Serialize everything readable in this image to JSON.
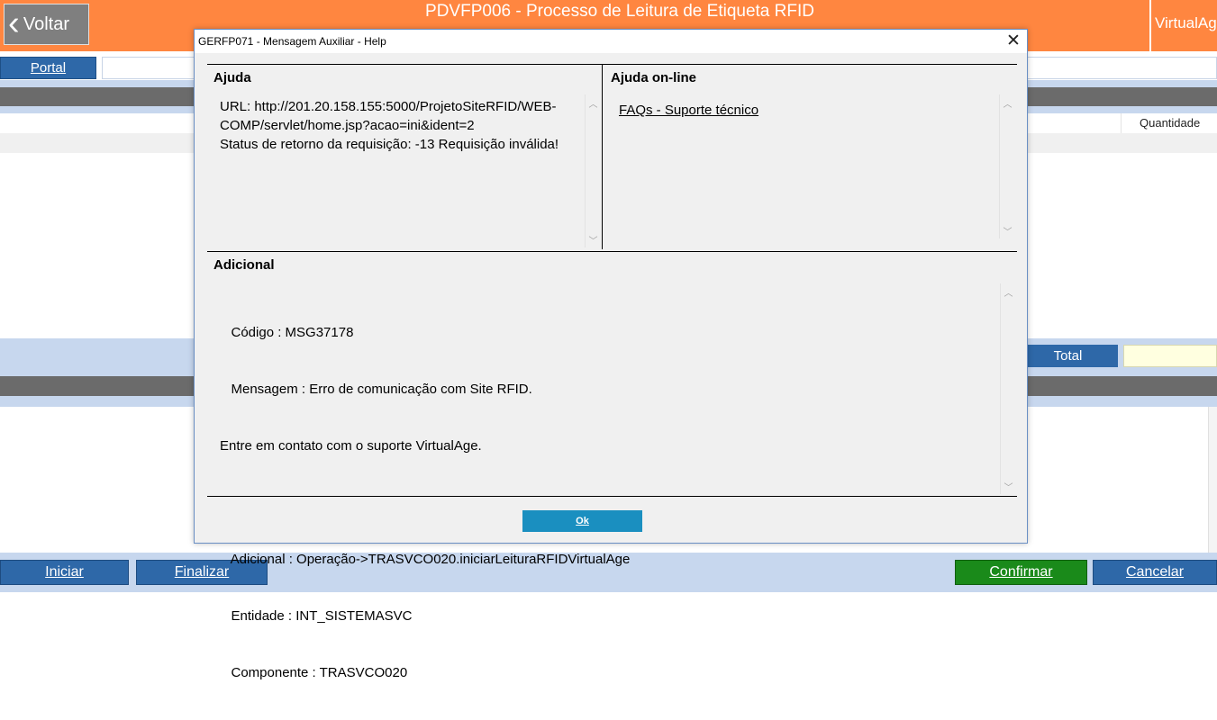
{
  "app": {
    "back_label": "Voltar",
    "back_chevron": "‹",
    "title": "PDVFP006 - Processo de Leitura de Etiqueta RFID",
    "brand": "VirtualAge",
    "portal_label": "Portal",
    "column_quantidade": "Quantidade",
    "total_label": "Total",
    "buttons": {
      "iniciar": "Iniciar",
      "finalizar": "Finalizar",
      "confirmar": "Confirmar",
      "cancelar": "Cancelar"
    },
    "colors": {
      "header_orange": "#ff8640",
      "button_blue": "#2e68a8",
      "confirm_green": "#1a8a1a",
      "band_gray": "#6b6b6b",
      "band_light_blue": "#c7d7ee"
    }
  },
  "dialog": {
    "title": "GERFP071 - Mensagem Auxiliar - Help",
    "close_glyph": "✕",
    "ajuda": {
      "heading": "Ajuda",
      "lines": [
        "URL: http://201.20.158.155:5000/ProjetoSiteRFID/WEB-",
        "COMP/servlet/home.jsp?acao=ini&ident=2",
        "Status de retorno da requisição: -13 Requisição inválida!"
      ]
    },
    "ajuda_online": {
      "heading": "Ajuda on-line",
      "link": "FAQs - Suporte técnico"
    },
    "adicional": {
      "heading": "Adicional",
      "lines": [
        "   Código : MSG37178",
        "   Mensagem : Erro de comunicação com Site RFID.",
        "Entre em contato com o suporte VirtualAge.",
        "",
        "   Adicional : Operação->TRASVCO020.iniciarLeituraRFIDVirtualAge",
        "   Entidade : INT_SISTEMASVC",
        "   Componente : TRASVCO020"
      ]
    },
    "ok_label": "Ok",
    "ok_color": "#1a8fc0",
    "scroll_up_glyph": "︿",
    "scroll_down_glyph": "﹀"
  }
}
